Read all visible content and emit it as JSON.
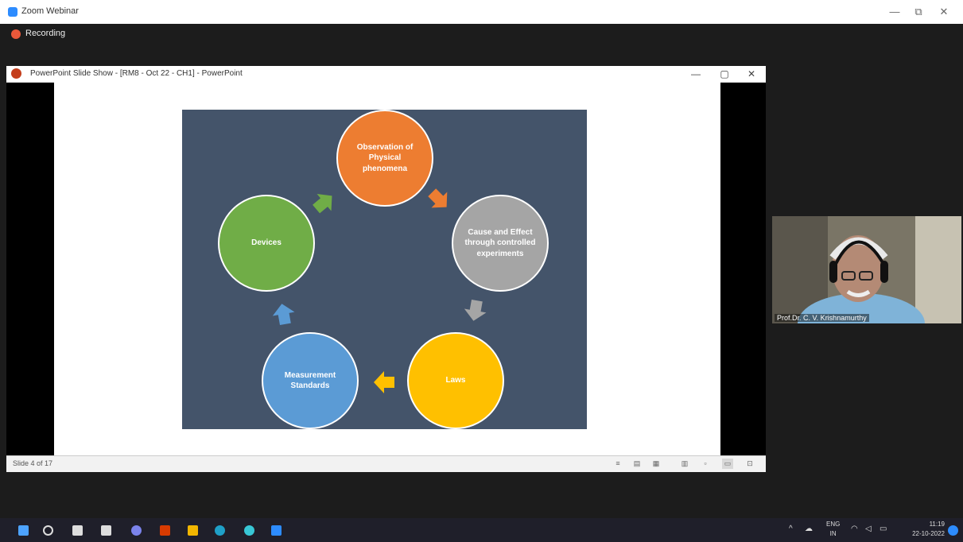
{
  "zoom_window": {
    "title": "Zoom Webinar",
    "minimize": "—",
    "restore": "⧉",
    "close": "✕",
    "recording_label": "Recording"
  },
  "ppt_window": {
    "title": "PowerPoint Slide Show - [RM8 - Oct 22 - CH1] - PowerPoint",
    "minimize": "—",
    "restore": "▢",
    "close": "✕",
    "slide_counter": "Slide 4 of 17",
    "view_icons": [
      "notes-icon",
      "normal-view-icon",
      "slide-sorter-icon",
      "reading-view-icon",
      "slideshow-icon"
    ]
  },
  "diagram": {
    "colors": {
      "background": "#44546a",
      "orange": "#ed7d31",
      "gray": "#a5a5a5",
      "yellow": "#ffc000",
      "blue": "#5b9bd5",
      "green": "#70ad47"
    },
    "nodes": [
      {
        "label": "Observation of Physical phenomena",
        "color": "#ed7d31"
      },
      {
        "label": "Cause and Effect through controlled experiments",
        "color": "#a5a5a5"
      },
      {
        "label": "Laws",
        "color": "#ffc000"
      },
      {
        "label": "Measurement Standards",
        "color": "#5b9bd5"
      },
      {
        "label": "Devices",
        "color": "#70ad47"
      }
    ]
  },
  "participant": {
    "name": "Prof.Dr. C. V. Krishnamurthy"
  },
  "taskbar": {
    "icons": [
      {
        "name": "start-icon",
        "color": "#4da3ff"
      },
      {
        "name": "search-icon",
        "color": "#dddddd"
      },
      {
        "name": "task-view-icon",
        "color": "#dddddd"
      },
      {
        "name": "widgets-icon",
        "color": "#dddddd"
      },
      {
        "name": "chat-icon",
        "color": "#7b83eb"
      },
      {
        "name": "office-icon",
        "color": "#d83b01"
      },
      {
        "name": "photos-icon",
        "color": "#f2b600"
      },
      {
        "name": "edge-icon",
        "color": "#1fa0c8"
      },
      {
        "name": "edge-dev-icon",
        "color": "#38c7d6"
      },
      {
        "name": "zoom-icon",
        "color": "#2d8cff"
      }
    ],
    "tray": {
      "language_top": "ENG",
      "language_bottom": "IN",
      "time": "11:19",
      "date": "22-10-2022"
    }
  }
}
